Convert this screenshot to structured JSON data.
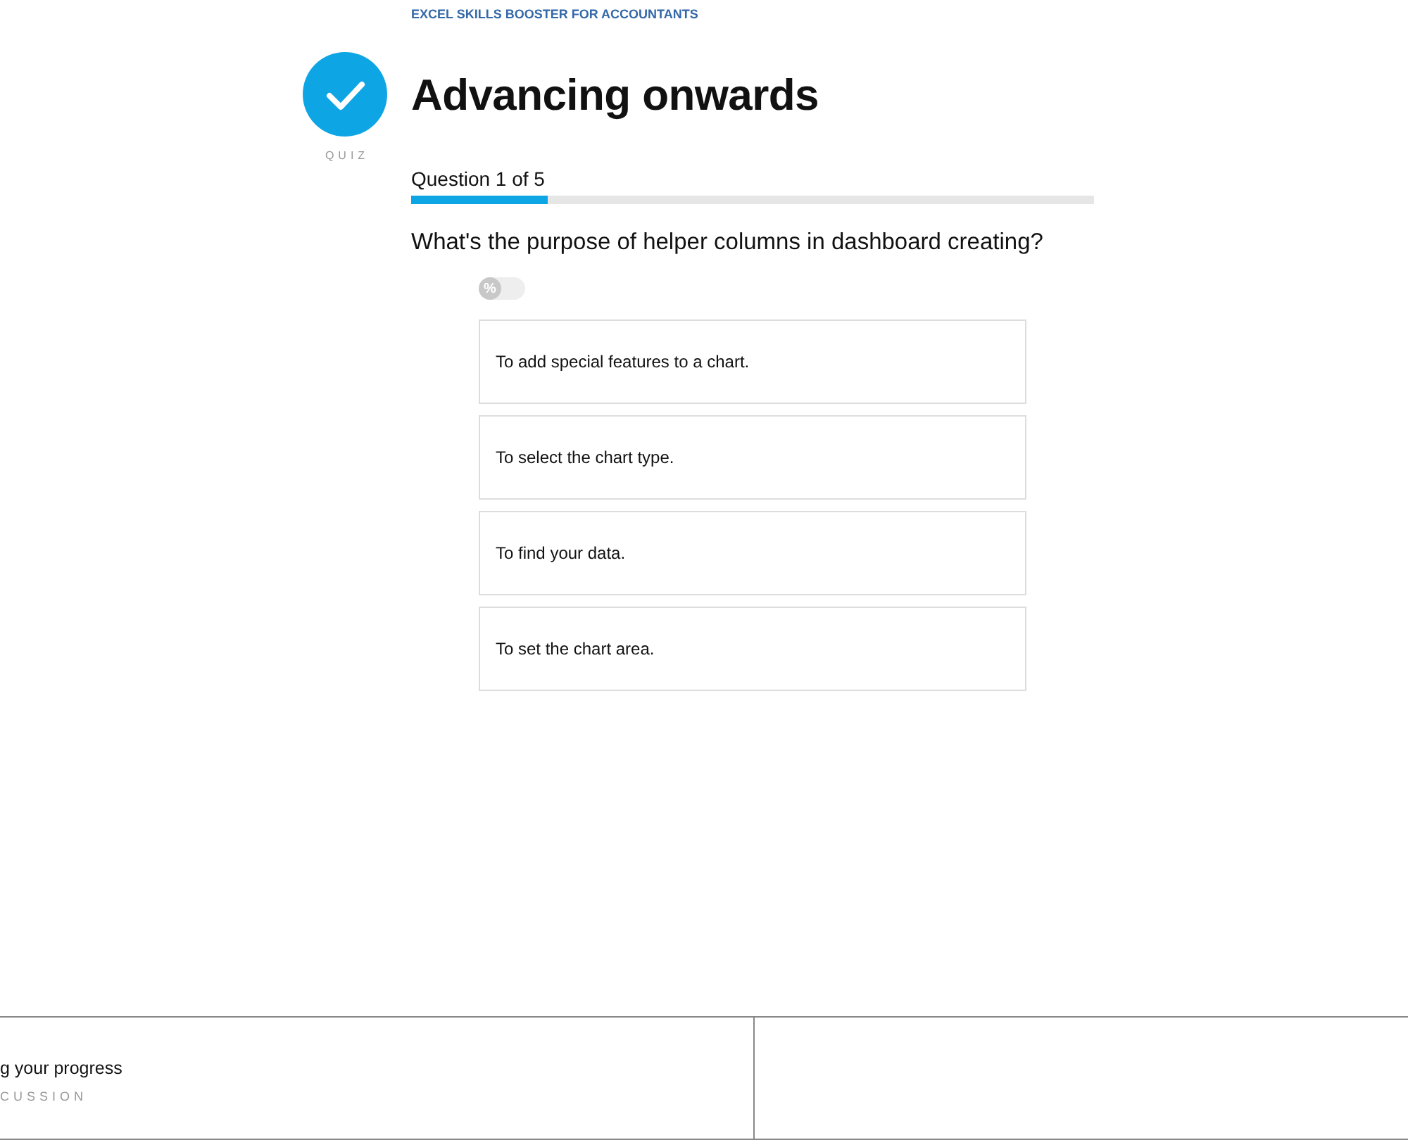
{
  "course_title": "EXCEL SKILLS BOOSTER FOR ACCOUNTANTS",
  "lesson": {
    "type_label": "QUIZ",
    "completed": true,
    "title": "Advancing onwards"
  },
  "progress": {
    "label": "Question 1 of 5",
    "level": 0.2
  },
  "question": "What's the purpose of helper columns in dashboard creating?",
  "percent_toggle": {
    "label": "%",
    "on": false
  },
  "answers": [
    {
      "text": "To add special features to a chart.",
      "selected": false
    },
    {
      "text": "To select the chart type.",
      "selected": false
    },
    {
      "text": "To find your data.",
      "selected": false
    },
    {
      "text": "To set the chart area.",
      "selected": false
    }
  ],
  "footer": {
    "previous": {
      "title": "g your progress",
      "type_label": "CUSSION"
    }
  }
}
